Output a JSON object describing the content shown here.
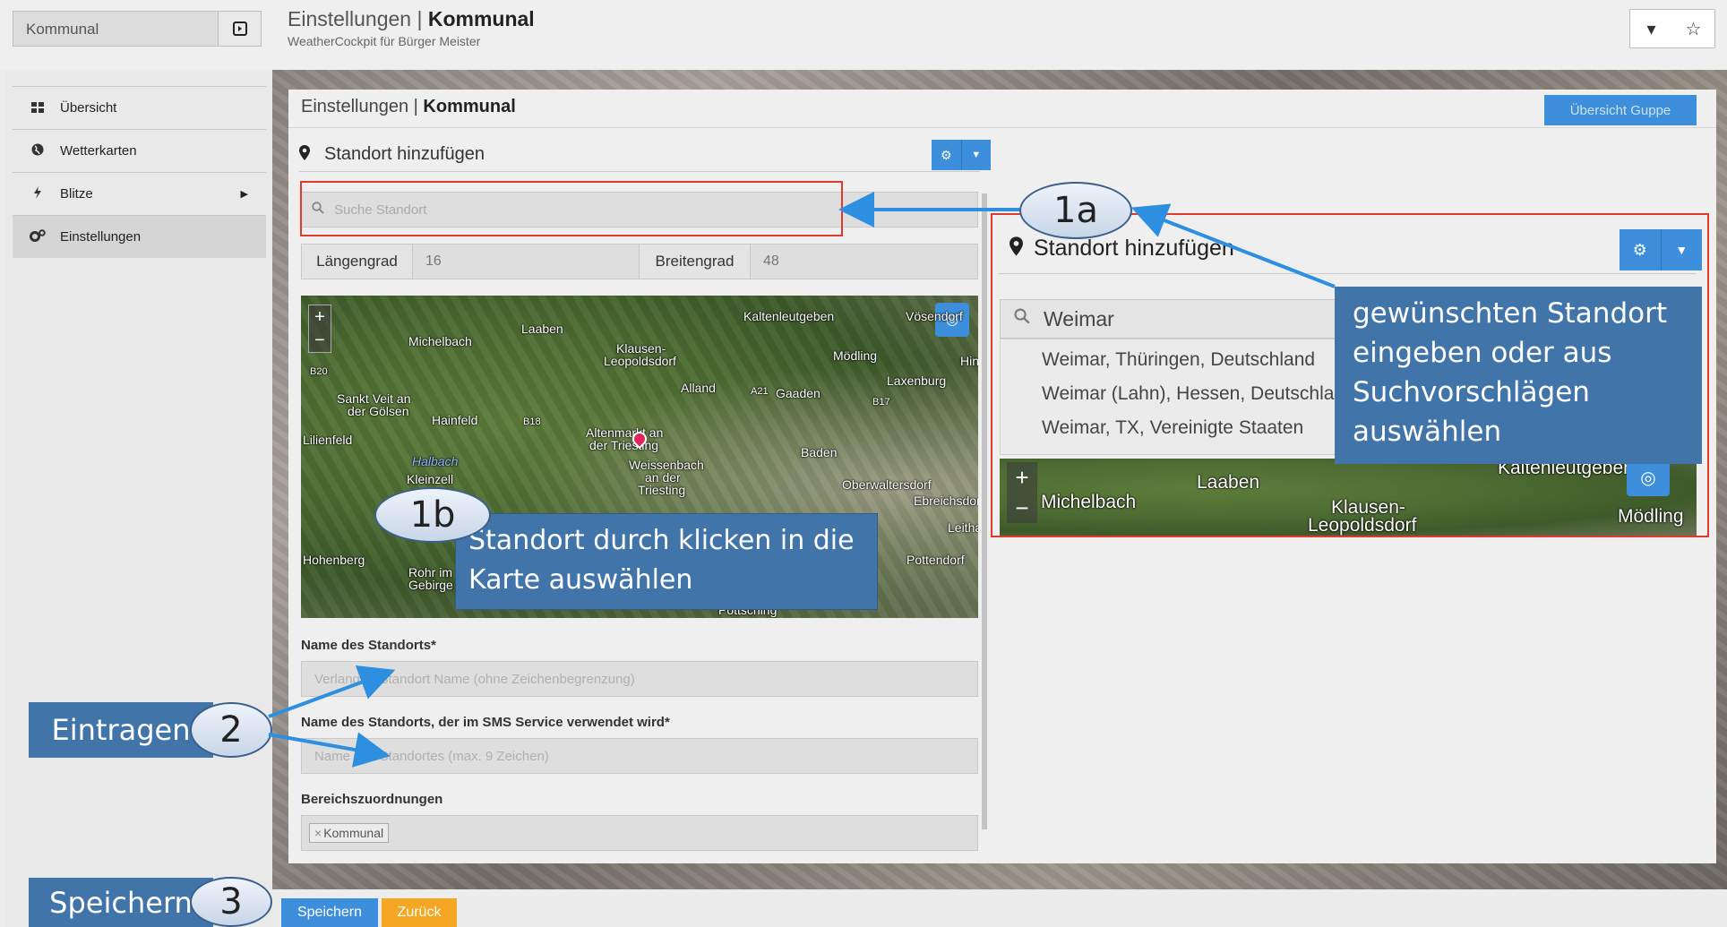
{
  "header": {
    "group_select": "Kommunal",
    "title_prefix": "Einstellungen |",
    "title_bold": "Kommunal",
    "subtitle": "WeatherCockpit für Bürger Meister",
    "right_icons": [
      "caret-down-icon",
      "star-icon"
    ]
  },
  "sidebar": {
    "items": [
      {
        "label": "Übersicht",
        "icon": "grid-icon"
      },
      {
        "label": "Wetterkarten",
        "icon": "globe-icon"
      },
      {
        "label": "Blitze",
        "icon": "bolt-icon"
      },
      {
        "label": "Einstellungen",
        "icon": "gears-icon"
      }
    ]
  },
  "panel": {
    "title_prefix": "Einstellungen |",
    "title_bold": "Kommunal",
    "overview_button": "Übersicht Guppe",
    "section_title": "Standort hinzufügen",
    "search_placeholder": "Suche Standort",
    "longitude_label": "Längengrad",
    "longitude_value": "16",
    "latitude_label": "Breitengrad",
    "latitude_value": "48",
    "name_label": "Name des Standorts*",
    "name_placeholder": "Verlangter Standort Name (ohne Zeichenbegrenzung)",
    "sms_label": "Name des Standorts, der im SMS Service verwendet wird*",
    "sms_placeholder": "Name des Standortes (max. 9 Zeichen)",
    "area_label": "Bereichszuordnungen",
    "area_tag": "Kommunal"
  },
  "map": {
    "places": [
      "Michelbach",
      "Laaben",
      "Kaltenleutgeben",
      "Vösendorf",
      "Klausen-",
      "Leopoldsdorf",
      "Mödling",
      "Hinterbrühl",
      "Alland",
      "Gaaden",
      "Laxenburg",
      "Sankt Veit an",
      "der Gölsen",
      "Hainfeld",
      "Altenmarkt an",
      "der Triesting",
      "Baden",
      "Lilienfeld",
      "Halbach",
      "Kleinzell",
      "Weissenbach",
      "an der",
      "Triesting",
      "Oberwaltersdorf",
      "Ebreichsdorf",
      "Hohenberg",
      "Rohr im",
      "Gebirge",
      "Pottendorf",
      "Pöttsching",
      "A21",
      "B20",
      "B18",
      "B17",
      "Leithaberg"
    ]
  },
  "inset": {
    "section_title": "Standort hinzufügen",
    "search_value": "Weimar",
    "suggestions": [
      "Weimar, Thüringen, Deutschland",
      "Weimar (Lahn), Hessen, Deutschland",
      "Weimar, TX, Vereinigte Staaten"
    ],
    "map_places": [
      "Michelbach",
      "Laaben",
      "Klausen-",
      "Leopoldsdorf",
      "Kaltenleutgeben",
      "Mödling"
    ]
  },
  "annotations": {
    "step_1a": "1a",
    "step_1b": "1b",
    "step_2": "2",
    "step_3": "3",
    "callout_1a": "gewünschten Standort eingeben oder  aus Suchvorschlägen auswählen",
    "callout_1b": "Standort durch klicken in die Karte auswählen",
    "callout_2": "Eintragen",
    "callout_3": "Speichern"
  },
  "footer": {
    "save_button": "Speichern",
    "back_button": "Zurück"
  },
  "colors": {
    "accent_blue": "#3d8fdb",
    "callout_blue": "#4174a8",
    "highlight_red": "#e03a2f",
    "save_orange": "#f5a623",
    "marker_pink": "#e0245e"
  }
}
